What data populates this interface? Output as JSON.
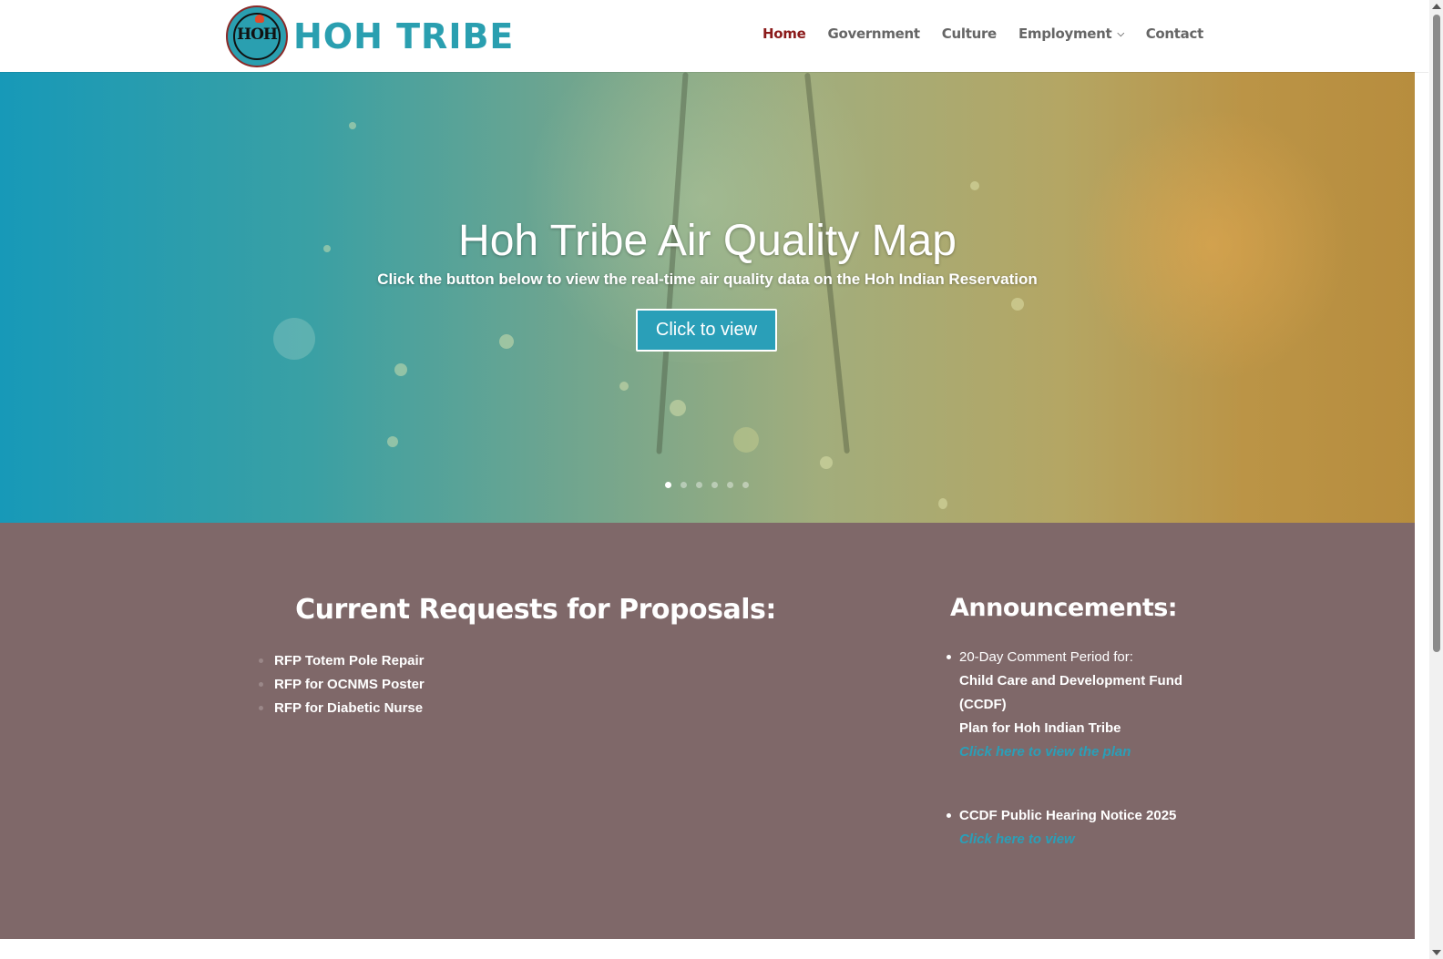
{
  "header": {
    "logo_text": "HOH TRIBE",
    "nav": [
      {
        "label": "Home",
        "active": true
      },
      {
        "label": "Government",
        "active": false
      },
      {
        "label": "Culture",
        "active": false
      },
      {
        "label": "Employment",
        "active": false,
        "has_dropdown": true
      },
      {
        "label": "Contact",
        "active": false
      }
    ]
  },
  "hero": {
    "title": "Hoh Tribe Air Quality Map",
    "subtitle": "Click the button below to view the real-time air quality data on the Hoh Indian Reservation",
    "button_label": "Click to view",
    "slides_total": 6,
    "active_slide": 1
  },
  "rfp": {
    "title": "Current Requests for Proposals:",
    "items": [
      "RFP Totem Pole Repair",
      "RFP for OCNMS Poster",
      "RFP for Diabetic Nurse"
    ]
  },
  "announcements": {
    "title": "Announcements:",
    "item1": {
      "intro": "20-Day Comment Period for:",
      "line1": "Child Care and Development Fund",
      "line2": "(CCDF)",
      "line3": "Plan for Hoh Indian Tribe",
      "link": "Click here to view the plan"
    },
    "item2": {
      "title": "CCDF Public Hearing Notice 2025",
      "link": "Click here to view"
    }
  },
  "colors": {
    "brand_teal": "#2a9fb0",
    "nav_active": "#8b1a1a",
    "content_bg": "#7f6869",
    "link": "#2a9fb8"
  }
}
